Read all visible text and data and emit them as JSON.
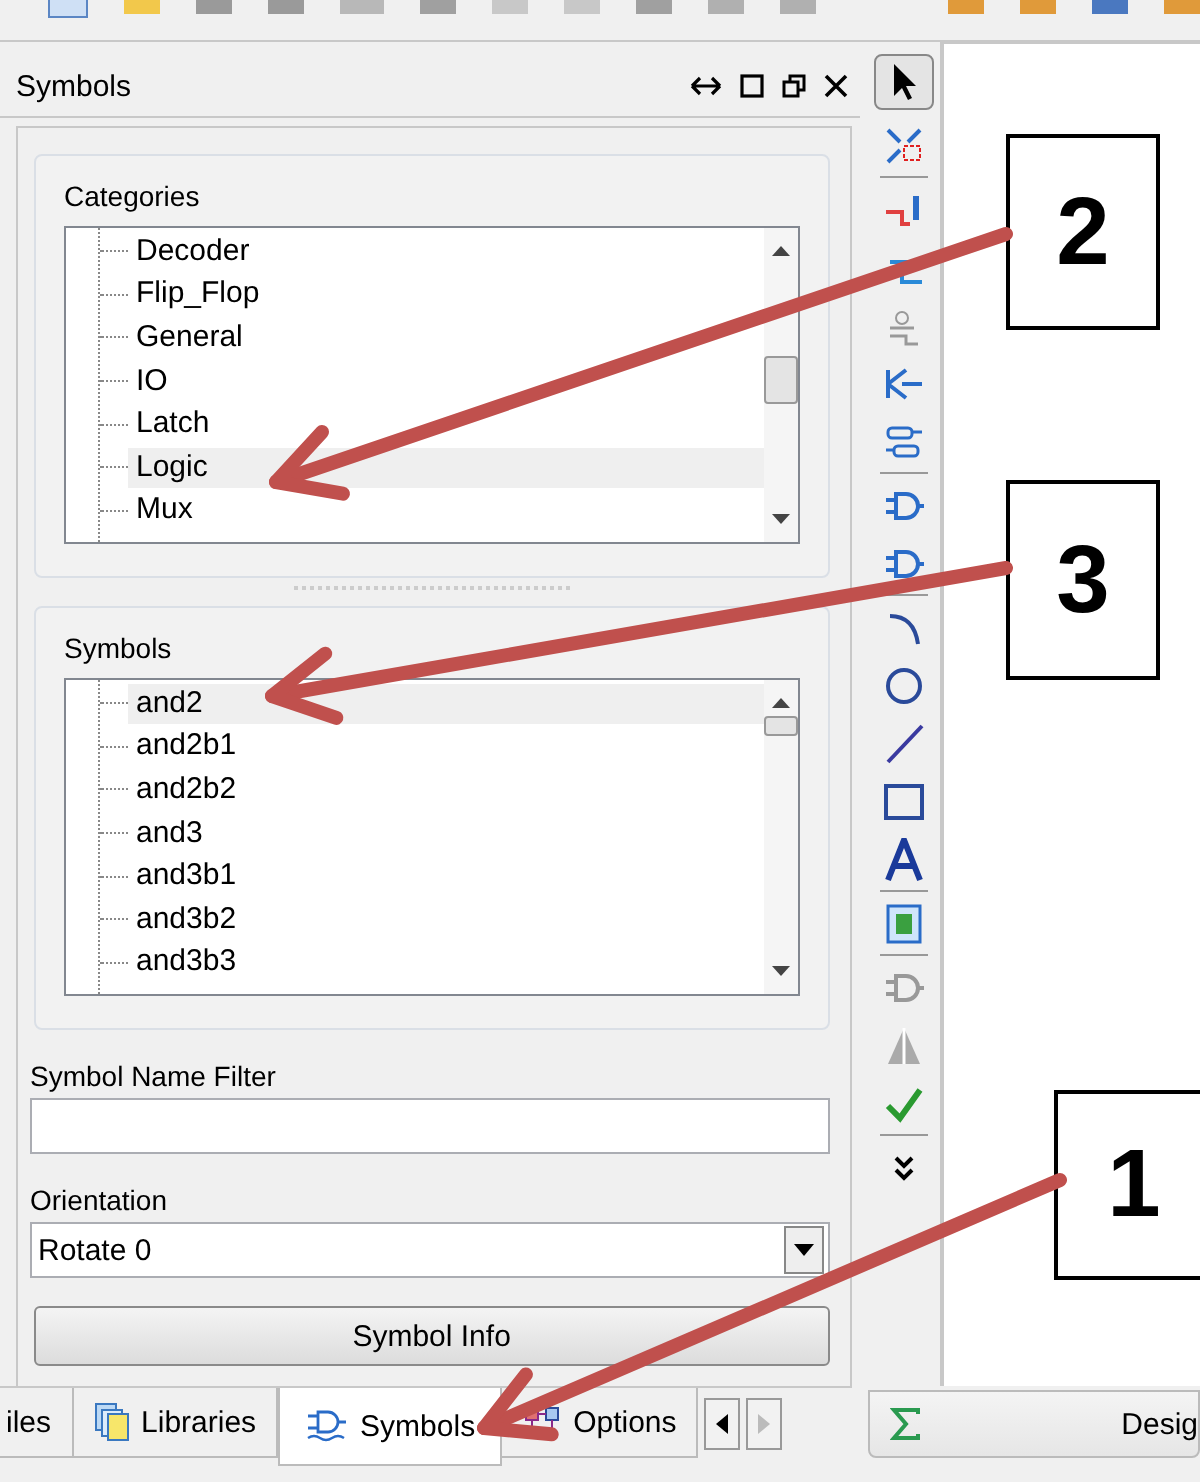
{
  "panel": {
    "title": "Symbols"
  },
  "categories": {
    "label": "Categories",
    "items": [
      {
        "label": "Decoder",
        "selected": false
      },
      {
        "label": "Flip_Flop",
        "selected": false
      },
      {
        "label": "General",
        "selected": false
      },
      {
        "label": "IO",
        "selected": false
      },
      {
        "label": "Latch",
        "selected": false
      },
      {
        "label": "Logic",
        "selected": true
      },
      {
        "label": "Mux",
        "selected": false
      }
    ]
  },
  "symbols": {
    "label": "Symbols",
    "items": [
      {
        "label": "and2",
        "selected": true
      },
      {
        "label": "and2b1",
        "selected": false
      },
      {
        "label": "and2b2",
        "selected": false
      },
      {
        "label": "and3",
        "selected": false
      },
      {
        "label": "and3b1",
        "selected": false
      },
      {
        "label": "and3b2",
        "selected": false
      },
      {
        "label": "and3b3",
        "selected": false
      }
    ]
  },
  "filter": {
    "label": "Symbol Name Filter"
  },
  "orientation": {
    "label": "Orientation",
    "value": "Rotate 0"
  },
  "info_button": "Symbol Info",
  "tabs": [
    {
      "label": "iles",
      "selected": false
    },
    {
      "label": "Libraries",
      "selected": false
    },
    {
      "label": "Symbols",
      "selected": true
    },
    {
      "label": "Options",
      "selected": false
    }
  ],
  "design_tab": {
    "label": "Desig"
  },
  "callouts": [
    {
      "label": "2"
    },
    {
      "label": "3"
    },
    {
      "label": "1"
    }
  ]
}
